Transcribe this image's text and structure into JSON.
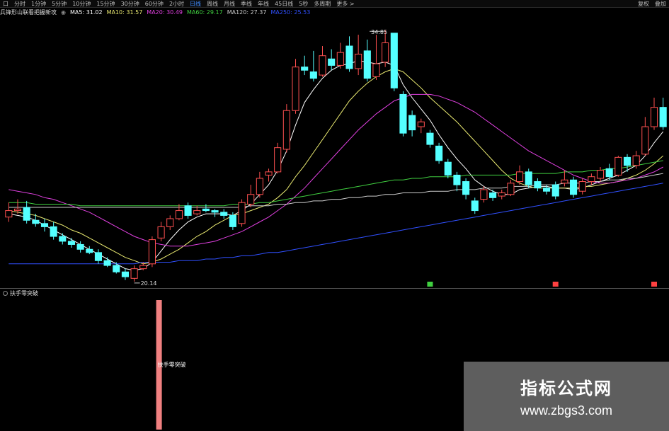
{
  "toolbar": {
    "left_items": [
      "口",
      "分时",
      "1分钟",
      "5分钟",
      "10分钟",
      "15分钟",
      "30分钟",
      "60分钟",
      "2小时",
      "日线",
      "周线",
      "月线",
      "季线",
      "年线",
      "45日线",
      "5秒",
      "多周期",
      "更多 >"
    ],
    "active_index": 9,
    "right_items": [
      "复权",
      "叠加"
    ]
  },
  "legend": {
    "title": "兵锋形山联看把握新攻",
    "items": [
      {
        "label": "MA5: 31.02",
        "color": "#ffffff"
      },
      {
        "label": "MA10: 31.57",
        "color": "#e8e870"
      },
      {
        "label": "MA20: 30.49",
        "color": "#e040e0"
      },
      {
        "label": "MA60: 29.17",
        "color": "#40d040"
      },
      {
        "label": "MA120: 27.37",
        "color": "#cccccc"
      },
      {
        "label": "MA250: 25.53",
        "color": "#3050ff"
      }
    ]
  },
  "price_labels": {
    "high": "34.85",
    "low": "20.14"
  },
  "indicator": {
    "title": "扶手零突破",
    "bar_label": "扶手零突破"
  },
  "watermark": {
    "title": "指标公式网",
    "url": "www.zbgs3.com"
  },
  "colors": {
    "up": "#ff5050",
    "down": "#54ffff",
    "ma5": "#ffffff",
    "ma10": "#e8e870",
    "ma20": "#e040e0",
    "ma60": "#40d040",
    "ma120": "#cccccc",
    "ma250": "#3050ff",
    "indicator_bar": "#f08080"
  },
  "chart_data": {
    "type": "candlestick",
    "candles": [
      [
        23.2,
        23.6,
        24.1,
        22.9
      ],
      [
        23.6,
        23.7,
        24.3,
        23.4
      ],
      [
        23.8,
        23.0,
        24.2,
        22.8
      ],
      [
        23.0,
        22.8,
        23.4,
        22.6
      ],
      [
        22.8,
        22.6,
        23.1,
        22.3
      ],
      [
        22.6,
        22.0,
        22.9,
        21.8
      ],
      [
        22.0,
        21.7,
        22.2,
        21.5
      ],
      [
        21.7,
        21.5,
        21.9,
        21.3
      ],
      [
        21.5,
        21.2,
        21.7,
        21.0
      ],
      [
        21.2,
        21.0,
        21.4,
        20.9
      ],
      [
        21.0,
        20.5,
        21.2,
        20.3
      ],
      [
        20.5,
        20.2,
        20.7,
        20.1
      ],
      [
        20.2,
        19.8,
        20.4,
        19.7
      ],
      [
        19.8,
        19.5,
        20.0,
        19.3
      ],
      [
        19.4,
        20.0,
        20.2,
        19.2
      ],
      [
        20.0,
        20.2,
        20.4,
        19.9
      ],
      [
        20.3,
        21.8,
        22.0,
        20.1
      ],
      [
        21.9,
        22.6,
        22.9,
        21.7
      ],
      [
        22.6,
        23.1,
        23.3,
        22.4
      ],
      [
        23.1,
        23.6,
        24.0,
        23.0
      ],
      [
        23.9,
        23.3,
        24.1,
        23.1
      ],
      [
        23.4,
        23.6,
        23.9,
        23.3
      ],
      [
        23.7,
        23.6,
        24.0,
        23.5
      ],
      [
        23.6,
        23.5,
        23.7,
        23.2
      ],
      [
        23.5,
        23.3,
        23.7,
        23.1
      ],
      [
        23.3,
        22.6,
        23.5,
        22.4
      ],
      [
        22.8,
        24.1,
        24.3,
        22.6
      ],
      [
        24.0,
        24.6,
        25.2,
        23.8
      ],
      [
        24.6,
        25.6,
        26.0,
        24.4
      ],
      [
        25.8,
        26.0,
        26.2,
        25.4
      ],
      [
        26.0,
        27.5,
        27.8,
        25.9
      ],
      [
        27.4,
        29.8,
        30.2,
        27.2
      ],
      [
        29.8,
        32.5,
        33.0,
        29.6
      ],
      [
        32.5,
        32.3,
        33.2,
        32.0
      ],
      [
        32.2,
        31.8,
        33.5,
        31.6
      ],
      [
        32.0,
        33.2,
        33.8,
        31.9
      ],
      [
        33.0,
        32.6,
        33.6,
        32.3
      ],
      [
        32.6,
        33.4,
        34.0,
        32.4
      ],
      [
        33.8,
        32.4,
        34.4,
        32.2
      ],
      [
        32.4,
        33.3,
        34.5,
        32.0
      ],
      [
        33.5,
        31.8,
        34.2,
        31.6
      ],
      [
        31.9,
        32.7,
        34.5,
        31.7
      ],
      [
        32.8,
        34.0,
        34.8,
        32.5
      ],
      [
        34.6,
        31.2,
        34.6,
        31.0
      ],
      [
        30.8,
        28.4,
        31.0,
        28.2
      ],
      [
        29.5,
        28.6,
        29.8,
        28.2
      ],
      [
        28.8,
        29.1,
        29.3,
        28.4
      ],
      [
        28.4,
        27.7,
        28.6,
        27.5
      ],
      [
        27.6,
        26.7,
        27.8,
        26.5
      ],
      [
        26.6,
        25.8,
        26.8,
        25.6
      ],
      [
        25.8,
        25.2,
        26.0,
        24.8
      ],
      [
        25.4,
        24.6,
        25.6,
        24.3
      ],
      [
        24.2,
        23.6,
        24.4,
        23.4
      ],
      [
        24.3,
        24.9,
        25.1,
        24.1
      ],
      [
        24.7,
        24.4,
        24.9,
        24.2
      ],
      [
        24.5,
        24.7,
        24.9,
        24.3
      ],
      [
        24.6,
        25.3,
        25.5,
        24.5
      ],
      [
        25.4,
        26.0,
        26.4,
        25.2
      ],
      [
        26.0,
        25.2,
        26.2,
        25.0
      ],
      [
        25.4,
        25.0,
        25.6,
        24.8
      ],
      [
        25.0,
        24.8,
        25.2,
        24.6
      ],
      [
        25.2,
        24.5,
        25.4,
        24.3
      ],
      [
        25.3,
        25.5,
        26.1,
        25.1
      ],
      [
        25.5,
        24.6,
        25.7,
        24.4
      ],
      [
        24.8,
        25.4,
        25.6,
        24.6
      ],
      [
        25.4,
        25.7,
        25.9,
        25.2
      ],
      [
        25.6,
        26.1,
        26.3,
        25.4
      ],
      [
        26.2,
        25.7,
        26.5,
        25.5
      ],
      [
        25.8,
        26.9,
        27.0,
        25.7
      ],
      [
        26.9,
        26.4,
        27.1,
        26.0
      ],
      [
        26.4,
        27.0,
        27.3,
        26.2
      ],
      [
        27.1,
        28.8,
        29.4,
        27.0
      ],
      [
        28.8,
        30.0,
        30.6,
        28.6
      ],
      [
        30.0,
        28.8,
        30.6,
        28.6
      ]
    ],
    "ma_lines": {
      "MA5": [
        23.4,
        23.3,
        23.2,
        23.0,
        22.7,
        22.4,
        22.1,
        21.8,
        21.5,
        21.2,
        20.9,
        20.6,
        20.3,
        20.0,
        19.9,
        20.0,
        20.4,
        21.1,
        21.8,
        22.4,
        22.9,
        23.2,
        23.4,
        23.4,
        23.4,
        23.3,
        23.6,
        24.0,
        24.6,
        25.2,
        26.1,
        27.3,
        28.9,
        30.3,
        31.1,
        31.8,
        32.3,
        32.6,
        32.7,
        32.9,
        32.8,
        32.7,
        32.8,
        32.6,
        31.4,
        30.6,
        29.9,
        29.2,
        28.3,
        27.5,
        26.8,
        26.2,
        25.5,
        25.1,
        24.8,
        24.6,
        24.6,
        24.9,
        25.0,
        25.1,
        25.1,
        25.0,
        25.0,
        24.9,
        25.0,
        25.2,
        25.4,
        25.6,
        25.8,
        26.1,
        26.4,
        27.0,
        27.8,
        28.5
      ],
      "MA10": [
        23.6,
        23.5,
        23.4,
        23.3,
        23.1,
        22.9,
        22.7,
        22.4,
        22.2,
        21.9,
        21.6,
        21.3,
        21.0,
        20.7,
        20.5,
        20.3,
        20.4,
        20.6,
        20.9,
        21.2,
        21.6,
        22.0,
        22.3,
        22.7,
        23.0,
        23.3,
        23.4,
        23.6,
        23.8,
        24.0,
        24.4,
        24.9,
        25.7,
        26.4,
        27.2,
        28.0,
        28.8,
        29.6,
        30.4,
        31.0,
        31.5,
        31.9,
        32.2,
        32.4,
        32.2,
        31.7,
        31.2,
        30.6,
        30.1,
        29.6,
        29.1,
        28.5,
        27.9,
        27.3,
        26.7,
        26.1,
        25.6,
        25.3,
        25.1,
        25.0,
        25.0,
        25.0,
        25.0,
        25.0,
        25.1,
        25.1,
        25.2,
        25.3,
        25.4,
        25.6,
        25.8,
        26.1,
        26.5,
        27.0
      ],
      "MA20": [
        24.9,
        24.8,
        24.7,
        24.6,
        24.4,
        24.3,
        24.1,
        23.9,
        23.7,
        23.5,
        23.2,
        22.9,
        22.6,
        22.3,
        22.0,
        21.8,
        21.6,
        21.5,
        21.4,
        21.4,
        21.4,
        21.5,
        21.6,
        21.7,
        21.9,
        22.1,
        22.3,
        22.6,
        22.9,
        23.2,
        23.6,
        24.0,
        24.5,
        25.0,
        25.6,
        26.2,
        26.8,
        27.4,
        28.0,
        28.6,
        29.1,
        29.6,
        30.0,
        30.4,
        30.6,
        30.8,
        30.8,
        30.8,
        30.7,
        30.5,
        30.3,
        30.0,
        29.7,
        29.3,
        28.9,
        28.5,
        28.1,
        27.7,
        27.3,
        27.0,
        26.7,
        26.4,
        26.1,
        25.8,
        25.6,
        25.4,
        25.3,
        25.3,
        25.4,
        25.5,
        25.6,
        25.8,
        26.0,
        26.3
      ],
      "MA60": [
        24.1,
        24.1,
        24.1,
        24.0,
        24.0,
        24.0,
        24.0,
        24.0,
        23.9,
        23.9,
        23.9,
        23.9,
        23.9,
        23.9,
        23.9,
        23.9,
        23.9,
        23.9,
        23.9,
        23.9,
        23.9,
        23.9,
        23.9,
        23.9,
        23.9,
        24.0,
        24.0,
        24.0,
        24.1,
        24.1,
        24.2,
        24.3,
        24.4,
        24.5,
        24.6,
        24.7,
        24.8,
        24.9,
        25.0,
        25.1,
        25.2,
        25.3,
        25.4,
        25.5,
        25.5,
        25.6,
        25.6,
        25.7,
        25.7,
        25.7,
        25.7,
        25.8,
        25.8,
        25.8,
        25.8,
        25.8,
        25.8,
        25.9,
        25.9,
        25.9,
        25.9,
        25.9,
        26.0,
        26.0,
        26.0,
        26.1,
        26.1,
        26.2,
        26.2,
        26.3,
        26.4,
        26.5,
        26.6,
        26.7
      ],
      "MA120": [
        23.8,
        23.8,
        23.8,
        23.8,
        23.8,
        23.8,
        23.8,
        23.8,
        23.8,
        23.8,
        23.8,
        23.8,
        23.8,
        23.8,
        23.8,
        23.8,
        23.8,
        23.8,
        23.8,
        23.8,
        23.8,
        23.8,
        23.8,
        23.8,
        23.8,
        23.8,
        23.8,
        23.9,
        23.9,
        23.9,
        24.0,
        24.0,
        24.1,
        24.1,
        24.2,
        24.2,
        24.3,
        24.3,
        24.4,
        24.4,
        24.5,
        24.5,
        24.6,
        24.6,
        24.7,
        24.7,
        24.7,
        24.8,
        24.8,
        24.8,
        24.9,
        24.9,
        24.9,
        25.0,
        25.0,
        25.0,
        25.1,
        25.1,
        25.1,
        25.2,
        25.2,
        25.2,
        25.3,
        25.3,
        25.3,
        25.4,
        25.4,
        25.5,
        25.5,
        25.6,
        25.6,
        25.7,
        25.8,
        25.9
      ],
      "MA250": [
        20.3,
        20.3,
        20.3,
        20.3,
        20.3,
        20.3,
        20.3,
        20.3,
        20.3,
        20.3,
        20.3,
        20.3,
        20.3,
        20.3,
        20.3,
        20.4,
        20.4,
        20.4,
        20.4,
        20.5,
        20.5,
        20.5,
        20.6,
        20.6,
        20.7,
        20.7,
        20.8,
        20.8,
        20.9,
        21.0,
        21.0,
        21.1,
        21.2,
        21.3,
        21.4,
        21.5,
        21.6,
        21.7,
        21.8,
        21.9,
        22.0,
        22.1,
        22.2,
        22.3,
        22.4,
        22.5,
        22.6,
        22.7,
        22.8,
        22.9,
        23.0,
        23.1,
        23.2,
        23.3,
        23.4,
        23.5,
        23.6,
        23.7,
        23.8,
        23.9,
        24.0,
        24.1,
        24.2,
        24.3,
        24.4,
        24.5,
        24.6,
        24.7,
        24.8,
        24.9,
        25.0,
        25.1,
        25.2,
        25.3
      ]
    },
    "y_range": [
      18.8,
      35.6
    ],
    "signal_markers": [
      {
        "index": 47,
        "color": "#40d040"
      },
      {
        "index": 61,
        "color": "#ff4040"
      },
      {
        "index": 72,
        "color": "#ff4040"
      }
    ],
    "indicator_bars": [
      {
        "index": 14,
        "value": 1
      }
    ]
  }
}
